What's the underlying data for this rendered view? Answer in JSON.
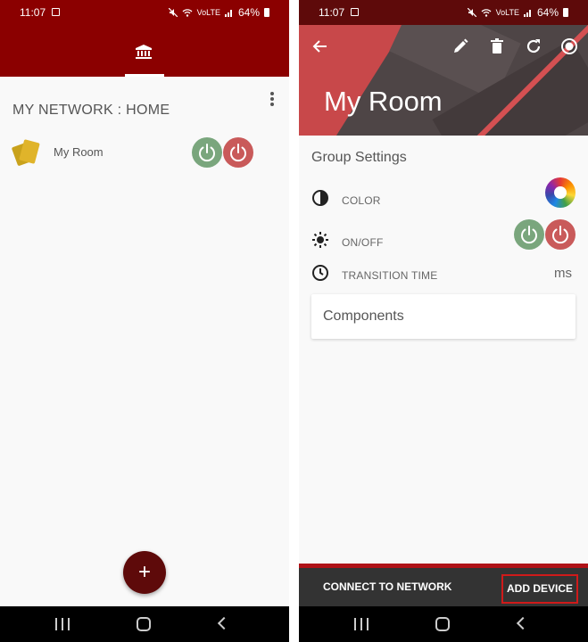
{
  "status_bar": {
    "time": "11:07",
    "volte": "VoLTE",
    "battery": "64%"
  },
  "screen1": {
    "network_title": "MY NETWORK : HOME",
    "room": {
      "label": "My Room"
    },
    "fab_label": "+"
  },
  "screen2": {
    "title": "My Room",
    "group_settings_label": "Group Settings",
    "settings": {
      "color_label": "COLOR",
      "onoff_label": "ON/OFF",
      "transition_label": "TRANSITION TIME",
      "transition_unit": "ms"
    },
    "components_label": "Components",
    "connect_label": "CONNECT TO NETWORK",
    "add_device_label": "ADD DEVICE"
  },
  "colors": {
    "primary": "#8b0000",
    "dark": "#5e0a0a",
    "power_on": "#7aa67d",
    "power_off": "#c95a5a",
    "bottom_bar": "#333333",
    "accent_border": "#d01a1a"
  },
  "icons": [
    "image-icon",
    "mute-icon",
    "wifi-icon",
    "signal-icon",
    "battery-icon",
    "bank-icon",
    "more-vert-icon",
    "room-icon",
    "power-icon",
    "back-arrow-icon",
    "edit-icon",
    "delete-icon",
    "refresh-icon",
    "record-icon",
    "contrast-icon",
    "brightness-icon",
    "clock-icon",
    "color-wheel-icon",
    "plus-icon",
    "recents-icon",
    "home-icon",
    "back-nav-icon"
  ]
}
